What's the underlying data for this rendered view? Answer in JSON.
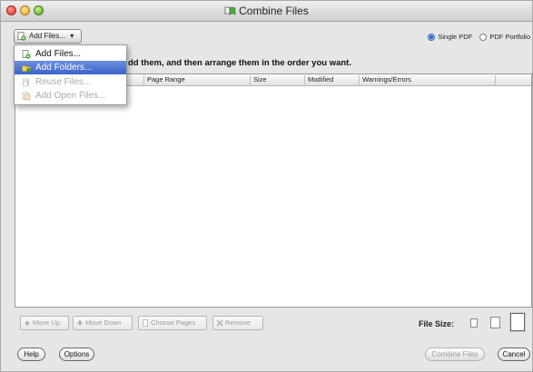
{
  "window": {
    "title": "Combine Files"
  },
  "toolbar": {
    "add_files_button": "Add Files...",
    "add_files_caret": "▾",
    "radio_single": "Single PDF",
    "radio_portfolio": "PDF Portfolio",
    "selected_option": "Single PDF"
  },
  "instruction": "dd them, and then arrange them in the order you want.",
  "columns": [
    "Page Range",
    "Size",
    "Modified",
    "Warnings/Errors"
  ],
  "menu": {
    "items": [
      {
        "label": "Add Files...",
        "state": "enabled"
      },
      {
        "label": "Add Folders...",
        "state": "highlighted"
      },
      {
        "label": "Reuse Files...",
        "state": "disabled"
      },
      {
        "label": "Add Open Files...",
        "state": "disabled"
      }
    ]
  },
  "bottom_buttons": {
    "move_up": "Move Up",
    "move_down": "Move Down",
    "choose_pages": "Choose Pages",
    "remove": "Remove"
  },
  "file_size_label": "File Size:",
  "footer": {
    "help": "Help",
    "options": "Options",
    "combine": "Combine Files",
    "cancel": "Cancel"
  },
  "colors": {
    "highlight": "#3c63c9",
    "window_bg": "#e6e6e6",
    "disabled_text": "#9a9a9a"
  }
}
